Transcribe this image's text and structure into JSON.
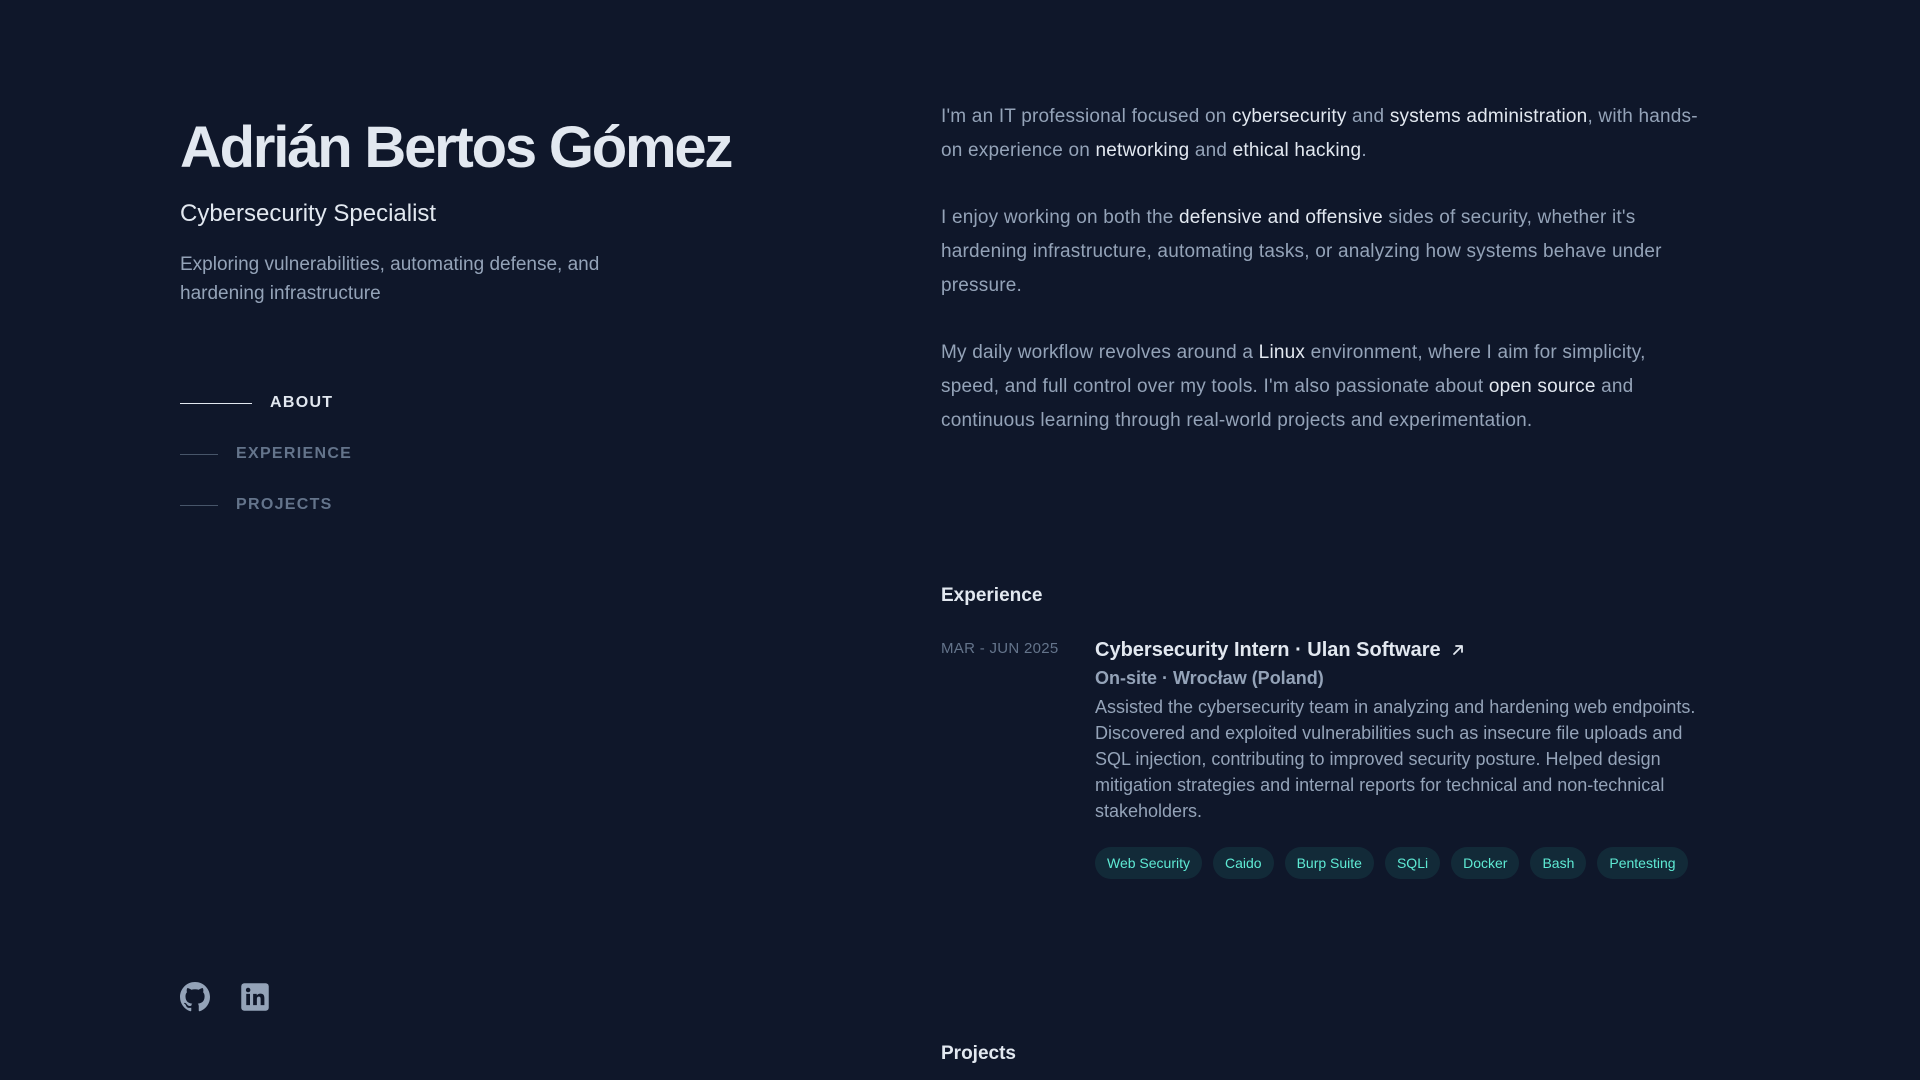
{
  "profile": {
    "name": "Adrián Bertos Gómez",
    "role": "Cybersecurity Specialist",
    "tagline": "Exploring vulnerabilities, automating defense, and hardening infrastructure"
  },
  "nav": {
    "about": "ABOUT",
    "experience": "EXPERIENCE",
    "projects": "PROJECTS"
  },
  "socials": {
    "github_icon": "github-icon",
    "linkedin_icon": "linkedin-icon"
  },
  "about": {
    "p1": [
      "I'm an IT professional focused on ",
      "cybersecurity",
      " and ",
      "systems administration",
      ", with hands-on experience on ",
      "networking",
      " and ",
      "ethical hacking",
      "."
    ],
    "p2": [
      "I enjoy working on both the ",
      "defensive and offensive",
      " sides of security, whether it's hardening infrastructure, automating tasks, or analyzing how systems behave under pressure."
    ],
    "p3": [
      "My daily workflow revolves around a ",
      "Linux",
      " environment, where I aim for simplicity, speed, and full control over my tools. I'm also passionate about ",
      "open source",
      " and continuous learning through real-world projects and experimentation."
    ]
  },
  "experience": {
    "title": "Experience",
    "jobs": [
      {
        "date": "MAR - JUN 2025",
        "heading": "Cybersecurity Intern · Ulan Software",
        "subheading": "On-site · Wrocław (Poland)",
        "description": "Assisted the cybersecurity team in analyzing and hardening web endpoints. Discovered and exploited vulnerabilities such as insecure file uploads and SQL injection, contributing to improved security posture. Helped design mitigation strategies and internal reports for technical and non-technical stakeholders.",
        "tags": [
          "Web Security",
          "Caido",
          "Burp Suite",
          "SQLi",
          "Docker",
          "Bash",
          "Pentesting"
        ]
      }
    ]
  },
  "projects": {
    "title": "Projects"
  },
  "colors": {
    "background": "#0f172a",
    "heading": "#e2e8f0",
    "body": "#94a3b8",
    "muted": "#64748b",
    "accent": "#5eead4"
  }
}
